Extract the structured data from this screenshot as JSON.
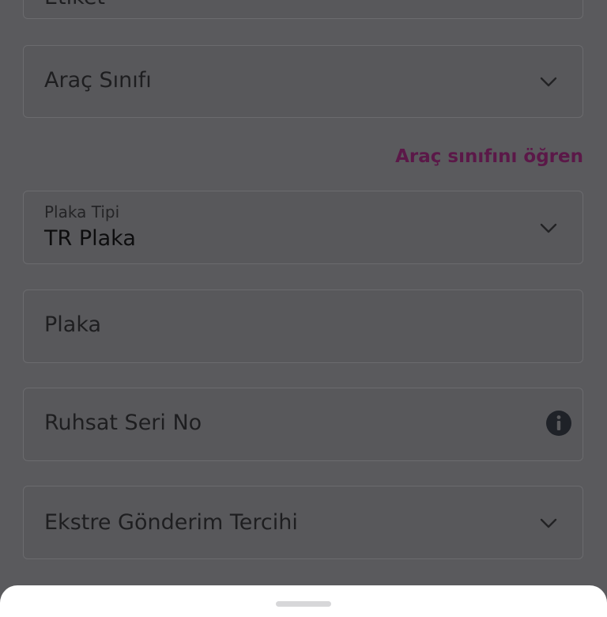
{
  "form": {
    "etiket": {
      "placeholder": "Etiket"
    },
    "arac_sinifi": {
      "placeholder": "Araç Sınıfı",
      "icon": "chevron-down-icon"
    },
    "arac_sinifi_link": "Araç sınıfını öğren",
    "plaka_tipi": {
      "label": "Plaka Tipi",
      "value": "TR Plaka",
      "icon": "chevron-down-icon"
    },
    "plaka": {
      "placeholder": "Plaka"
    },
    "ruhsat_seri_no": {
      "placeholder": "Ruhsat Seri No",
      "icon": "info-icon"
    },
    "ekstre_gonderim_tercihi": {
      "placeholder": "Ekstre Gönderim Tercihi",
      "icon": "chevron-down-icon"
    }
  },
  "colors": {
    "overlay": "#5a5a5d",
    "link": "#5b1848",
    "sheet": "#ffffff"
  }
}
